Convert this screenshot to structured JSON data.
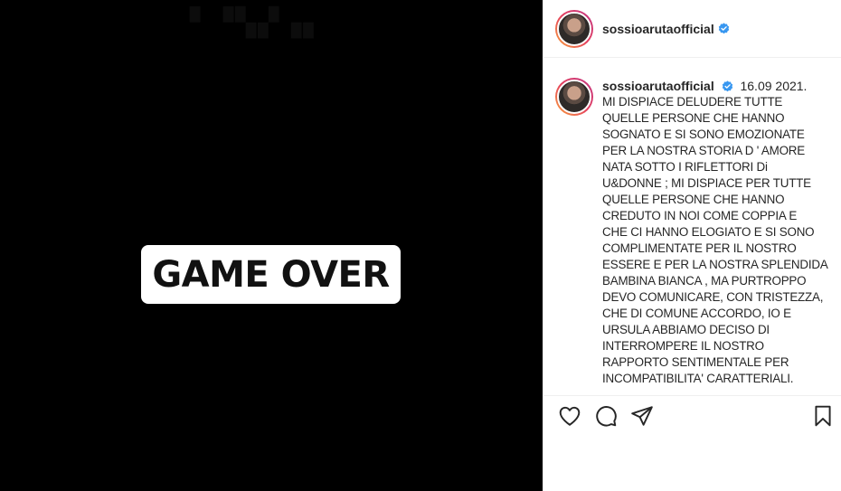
{
  "post": {
    "username": "sossioarutaofficial",
    "media_text": "GAME OVER",
    "date": "16.09 2021.",
    "caption": "MI DISPIACE DELUDERE TUTTE\nQUELLE PERSONE CHE HANNO\nSOGNATO E SI SONO EMOZIONATE\nPER LA NOSTRA STORIA D ' AMORE\nNATA SOTTO I RIFLETTORI Di\nU&DONNE ; MI DISPIACE PER TUTTE\nQUELLE PERSONE CHE HANNO\nCREDUTO IN NOI COME COPPIA E\nCHE CI HANNO ELOGIATO E SI SONO\nCOMPLIMENTATE PER IL NOSTRO\nESSERE E PER LA NOSTRA SPLENDIDA\nBAMBINA BIANCA , MA PURTROPPO\nDEVO COMUNICARE, CON TRISTEZZA,\nCHE DI COMUNE ACCORDO, IO E\nURSULA ABBIAMO DECISO DI\nINTERROMPERE IL NOSTRO\nRAPPORTO SENTIMENTALE PER\nINCOMPATIBILITA' CARATTERIALI."
  },
  "icons": {
    "verified": "verified-badge-icon",
    "like": "heart-icon",
    "comment": "comment-icon",
    "share": "paper-plane-icon",
    "save": "bookmark-icon"
  },
  "colors": {
    "verified": "#3897f0",
    "media_background": "#000000",
    "text": "#262626"
  }
}
